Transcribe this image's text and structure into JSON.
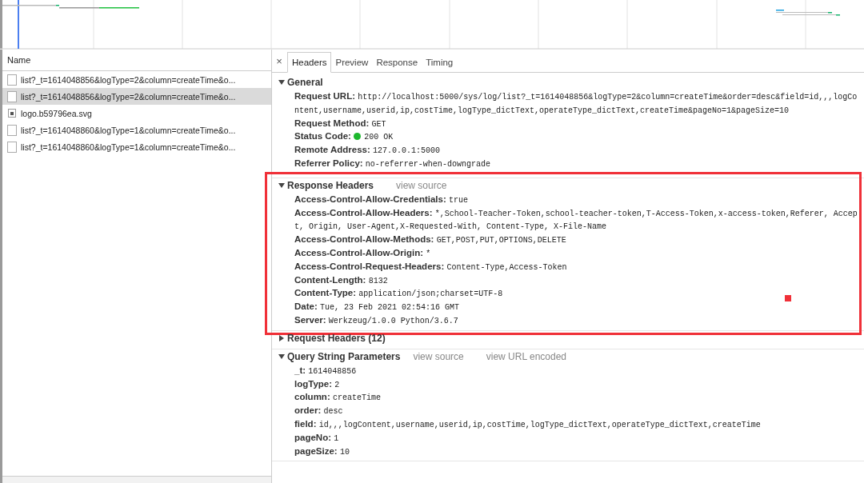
{
  "requests_panel": {
    "column_header": "Name",
    "requests": [
      {
        "name": "list?_t=1614048856&logType=2&column=createTime&o...",
        "kind": "document",
        "selected": false
      },
      {
        "name": "list?_t=1614048856&logType=2&column=createTime&o...",
        "kind": "document",
        "selected": true
      },
      {
        "name": "logo.b59796ea.svg",
        "kind": "image",
        "selected": false
      },
      {
        "name": "list?_t=1614048860&logType=1&column=createTime&o...",
        "kind": "document",
        "selected": false
      },
      {
        "name": "list?_t=1614048860&logType=1&column=createTime&o...",
        "kind": "document",
        "selected": false
      }
    ]
  },
  "details_panel": {
    "close": "×",
    "tabs": [
      {
        "label": "Headers",
        "selected": true
      },
      {
        "label": "Preview",
        "selected": false
      },
      {
        "label": "Response",
        "selected": false
      },
      {
        "label": "Timing",
        "selected": false
      }
    ],
    "sections": [
      {
        "title": "General",
        "expanded": true,
        "rows": [
          {
            "key": "Request URL:",
            "value": "http://localhost:5000/sys/log/list?_t=1614048856&logType=2&column=createTime&order=desc&field=id,,,logContent,username,userid,ip,costTime,logType_dictText,operateType_dictText,createTime&pageNo=1&pageSize=10"
          },
          {
            "key": "Request Method:",
            "value": "GET"
          },
          {
            "key": "Status Code:",
            "value": "200 OK",
            "color": "#1db82e"
          },
          {
            "key": "Remote Address:",
            "value": "127.0.0.1:5000"
          },
          {
            "key": "Referrer Policy:",
            "value": "no-referrer-when-downgrade"
          }
        ]
      },
      {
        "title": "Response Headers",
        "expanded": true,
        "highlighted": true,
        "links": [
          "view source"
        ],
        "rows": [
          {
            "key": "Access-Control-Allow-Credentials:",
            "value": "true"
          },
          {
            "key": "Access-Control-Allow-Headers:",
            "value": "*,School-Teacher-Token,school-teacher-token,T-Access-Token,x-access-token,Referer, Accept, Origin, User-Agent,X-Requested-With, Content-Type, X-File-Name"
          },
          {
            "key": "Access-Control-Allow-Methods:",
            "value": "GET,POST,PUT,OPTIONS,DELETE"
          },
          {
            "key": "Access-Control-Allow-Origin:",
            "value": "*"
          },
          {
            "key": "Access-Control-Request-Headers:",
            "value": "Content-Type,Access-Token"
          },
          {
            "key": "Content-Length:",
            "value": "8132"
          },
          {
            "key": "Content-Type:",
            "value": "application/json;charset=UTF-8"
          },
          {
            "key": "Date:",
            "value": "Tue, 23 Feb 2021 02:54:16 GMT"
          },
          {
            "key": "Server:",
            "value": "Werkzeug/1.0.0 Python/3.6.7"
          }
        ]
      },
      {
        "title": "Request Headers (12)",
        "expanded": false
      },
      {
        "title": "Query String Parameters",
        "expanded": true,
        "links": [
          "view source",
          "view URL encoded"
        ],
        "rows": [
          {
            "key": "_t:",
            "value": "1614048856"
          },
          {
            "key": "logType:",
            "value": "2"
          },
          {
            "key": "column:",
            "value": "createTime"
          },
          {
            "key": "order:",
            "value": "desc"
          },
          {
            "key": "field:",
            "value": "id,,,logContent,username,userid,ip,costTime,logType_dictText,operateType_dictText,createTime"
          },
          {
            "key": "pageNo:",
            "value": "1"
          },
          {
            "key": "pageSize:",
            "value": "10"
          }
        ]
      }
    ]
  }
}
